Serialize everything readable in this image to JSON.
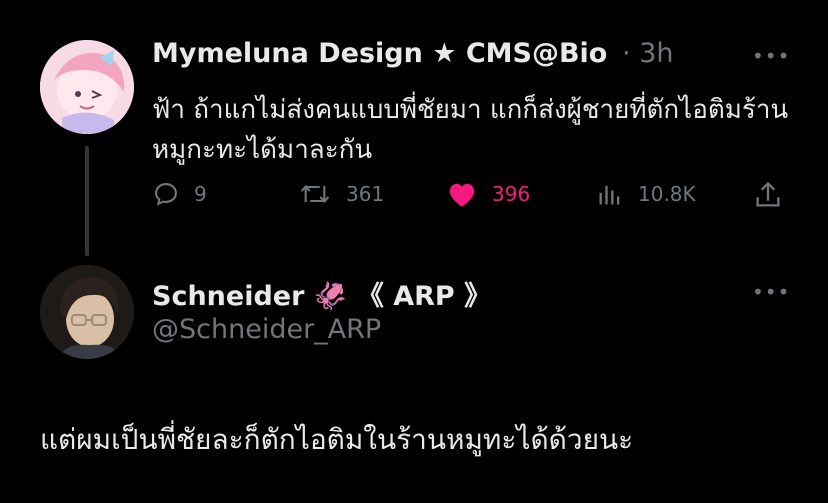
{
  "tweet": {
    "author_name": "Mymeluna Design ★ CMS@Bio",
    "time_sep": "·",
    "time": "3h",
    "text": "ฟ้า ถ้าแกไม่ส่งคนแบบพี่ชัยมา แกก็ส่งผู้ชายที่ตักไอติมร้านหมูกะทะได้มาละกัน",
    "more_label": "•••",
    "actions": {
      "replies": "9",
      "reposts": "361",
      "likes": "396",
      "views": "10.8K"
    },
    "liked": true
  },
  "reply": {
    "author_name": "Schneider 🦑 《 ARP 》",
    "handle": "@Schneider_ARP",
    "more_label": "•••",
    "text": "แต่ผมเป็นพี่ชัยละก็ตักไอติมในร้านหมูทะได้ด้วยนะ"
  },
  "colors": {
    "background": "#000000",
    "text": "#e7e9ea",
    "muted": "#71767b",
    "like": "#f91880"
  }
}
